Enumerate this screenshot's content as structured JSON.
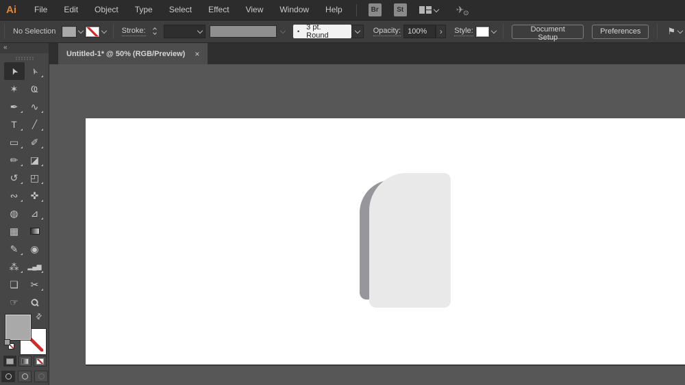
{
  "app": {
    "logo": "Ai"
  },
  "menu_bar": {
    "items": [
      "File",
      "Edit",
      "Object",
      "Type",
      "Select",
      "Effect",
      "View",
      "Window",
      "Help"
    ],
    "bridge": "Br",
    "stock": "St"
  },
  "control_bar": {
    "selection_status": "No Selection",
    "stroke_label": "Stroke:",
    "brush_name": "3 pt. Round",
    "opacity_label": "Opacity:",
    "opacity_value": "100%",
    "style_label": "Style:",
    "document_setup": "Document Setup",
    "preferences": "Preferences"
  },
  "tab": {
    "title": "Untitled-1* @ 50% (RGB/Preview)",
    "close": "×"
  },
  "toolbar": {
    "collapse": "«",
    "tools": [
      {
        "name": "selection",
        "glyph": "➤"
      },
      {
        "name": "direct-selection",
        "glyph": "➣"
      },
      {
        "name": "magic-wand",
        "glyph": "✶"
      },
      {
        "name": "lasso",
        "glyph": "Ҩ"
      },
      {
        "name": "pen",
        "glyph": "✒"
      },
      {
        "name": "curvature",
        "glyph": "∿"
      },
      {
        "name": "type",
        "glyph": "T"
      },
      {
        "name": "line-segment",
        "glyph": "╱"
      },
      {
        "name": "rectangle",
        "glyph": "▭"
      },
      {
        "name": "paintbrush",
        "glyph": "✐"
      },
      {
        "name": "pencil",
        "glyph": "✏"
      },
      {
        "name": "eraser",
        "glyph": "◪"
      },
      {
        "name": "rotate",
        "glyph": "↺"
      },
      {
        "name": "scale",
        "glyph": "◰"
      },
      {
        "name": "width",
        "glyph": "∾"
      },
      {
        "name": "puppet-warp",
        "glyph": "✜"
      },
      {
        "name": "shape-builder",
        "glyph": "◍"
      },
      {
        "name": "perspective-grid",
        "glyph": "⊿"
      },
      {
        "name": "mesh",
        "glyph": "▦"
      },
      {
        "name": "gradient",
        "glyph": ""
      },
      {
        "name": "eyedropper",
        "glyph": "✎"
      },
      {
        "name": "blend",
        "glyph": "◉"
      },
      {
        "name": "symbol-sprayer",
        "glyph": "⁂"
      },
      {
        "name": "column-graph",
        "glyph": "▂▄▆"
      },
      {
        "name": "artboard",
        "glyph": "❏"
      },
      {
        "name": "slice",
        "glyph": "✂"
      },
      {
        "name": "hand",
        "glyph": "☞"
      },
      {
        "name": "zoom",
        "glyph": "Ϙ"
      }
    ]
  },
  "icons": {
    "swap": "⇄",
    "brush_dot": "•",
    "more": "›",
    "flag": "⚑",
    "plane": "✈",
    "power": "⊙"
  },
  "colors": {
    "accent_orange": "#E8862E",
    "fill_swatch": "#A9A9A9",
    "canvas_background": "#575757",
    "artboard": "#FFFFFF",
    "shape_fill": "#E9E9EA",
    "shape_shadow": "#97979B",
    "none_red": "#D02A2A"
  }
}
